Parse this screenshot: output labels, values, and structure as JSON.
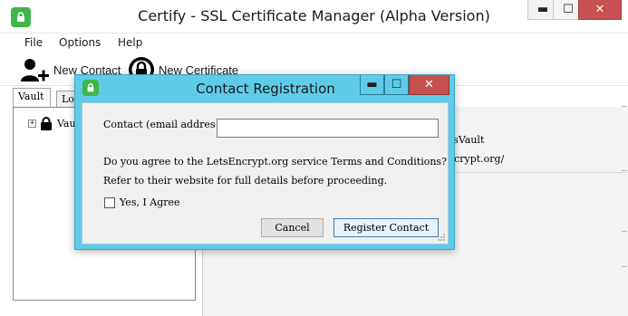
{
  "window": {
    "title": "Certify - SSL Certificate Manager (Alpha Version)",
    "minimize_glyph": "▬",
    "maximize_glyph": "☐",
    "close_glyph": "✕"
  },
  "menu": {
    "items": [
      {
        "label": "File"
      },
      {
        "label": "Options"
      },
      {
        "label": "Help"
      }
    ]
  },
  "toolbar": {
    "new_contact_label": "New Contact",
    "new_certificate_label": "New Certificate"
  },
  "tabs": [
    {
      "label": "Vault",
      "active": true
    },
    {
      "label": "Log",
      "active": false
    }
  ],
  "tree": {
    "root_label": "Vault",
    "expander_glyph": "+"
  },
  "details": {
    "vault_text": "ysVault",
    "url_text": "ncrypt.org/"
  },
  "dialog": {
    "title": "Contact Registration",
    "email_label": "Contact (email address)",
    "email_value": "",
    "terms_line1": "Do you agree to the LetsEncrypt.org service Terms and Conditions?",
    "terms_line2": "Refer to their website for full details before proceeding.",
    "agree_label": "Yes, I Agree",
    "agree_checked": false,
    "cancel_label": "Cancel",
    "register_label": "Register Contact",
    "minimize_glyph": "▬",
    "maximize_glyph": "☐",
    "close_glyph": "✕"
  },
  "colors": {
    "dialog_frame": "#5ecbe9",
    "app_icon_green": "#3fb54a",
    "close_red": "#c75050"
  },
  "icons": {
    "app": "lock-icon",
    "new_contact": "add-user-icon",
    "new_certificate": "certificate-lock-icon",
    "tree_node": "padlock-icon"
  }
}
